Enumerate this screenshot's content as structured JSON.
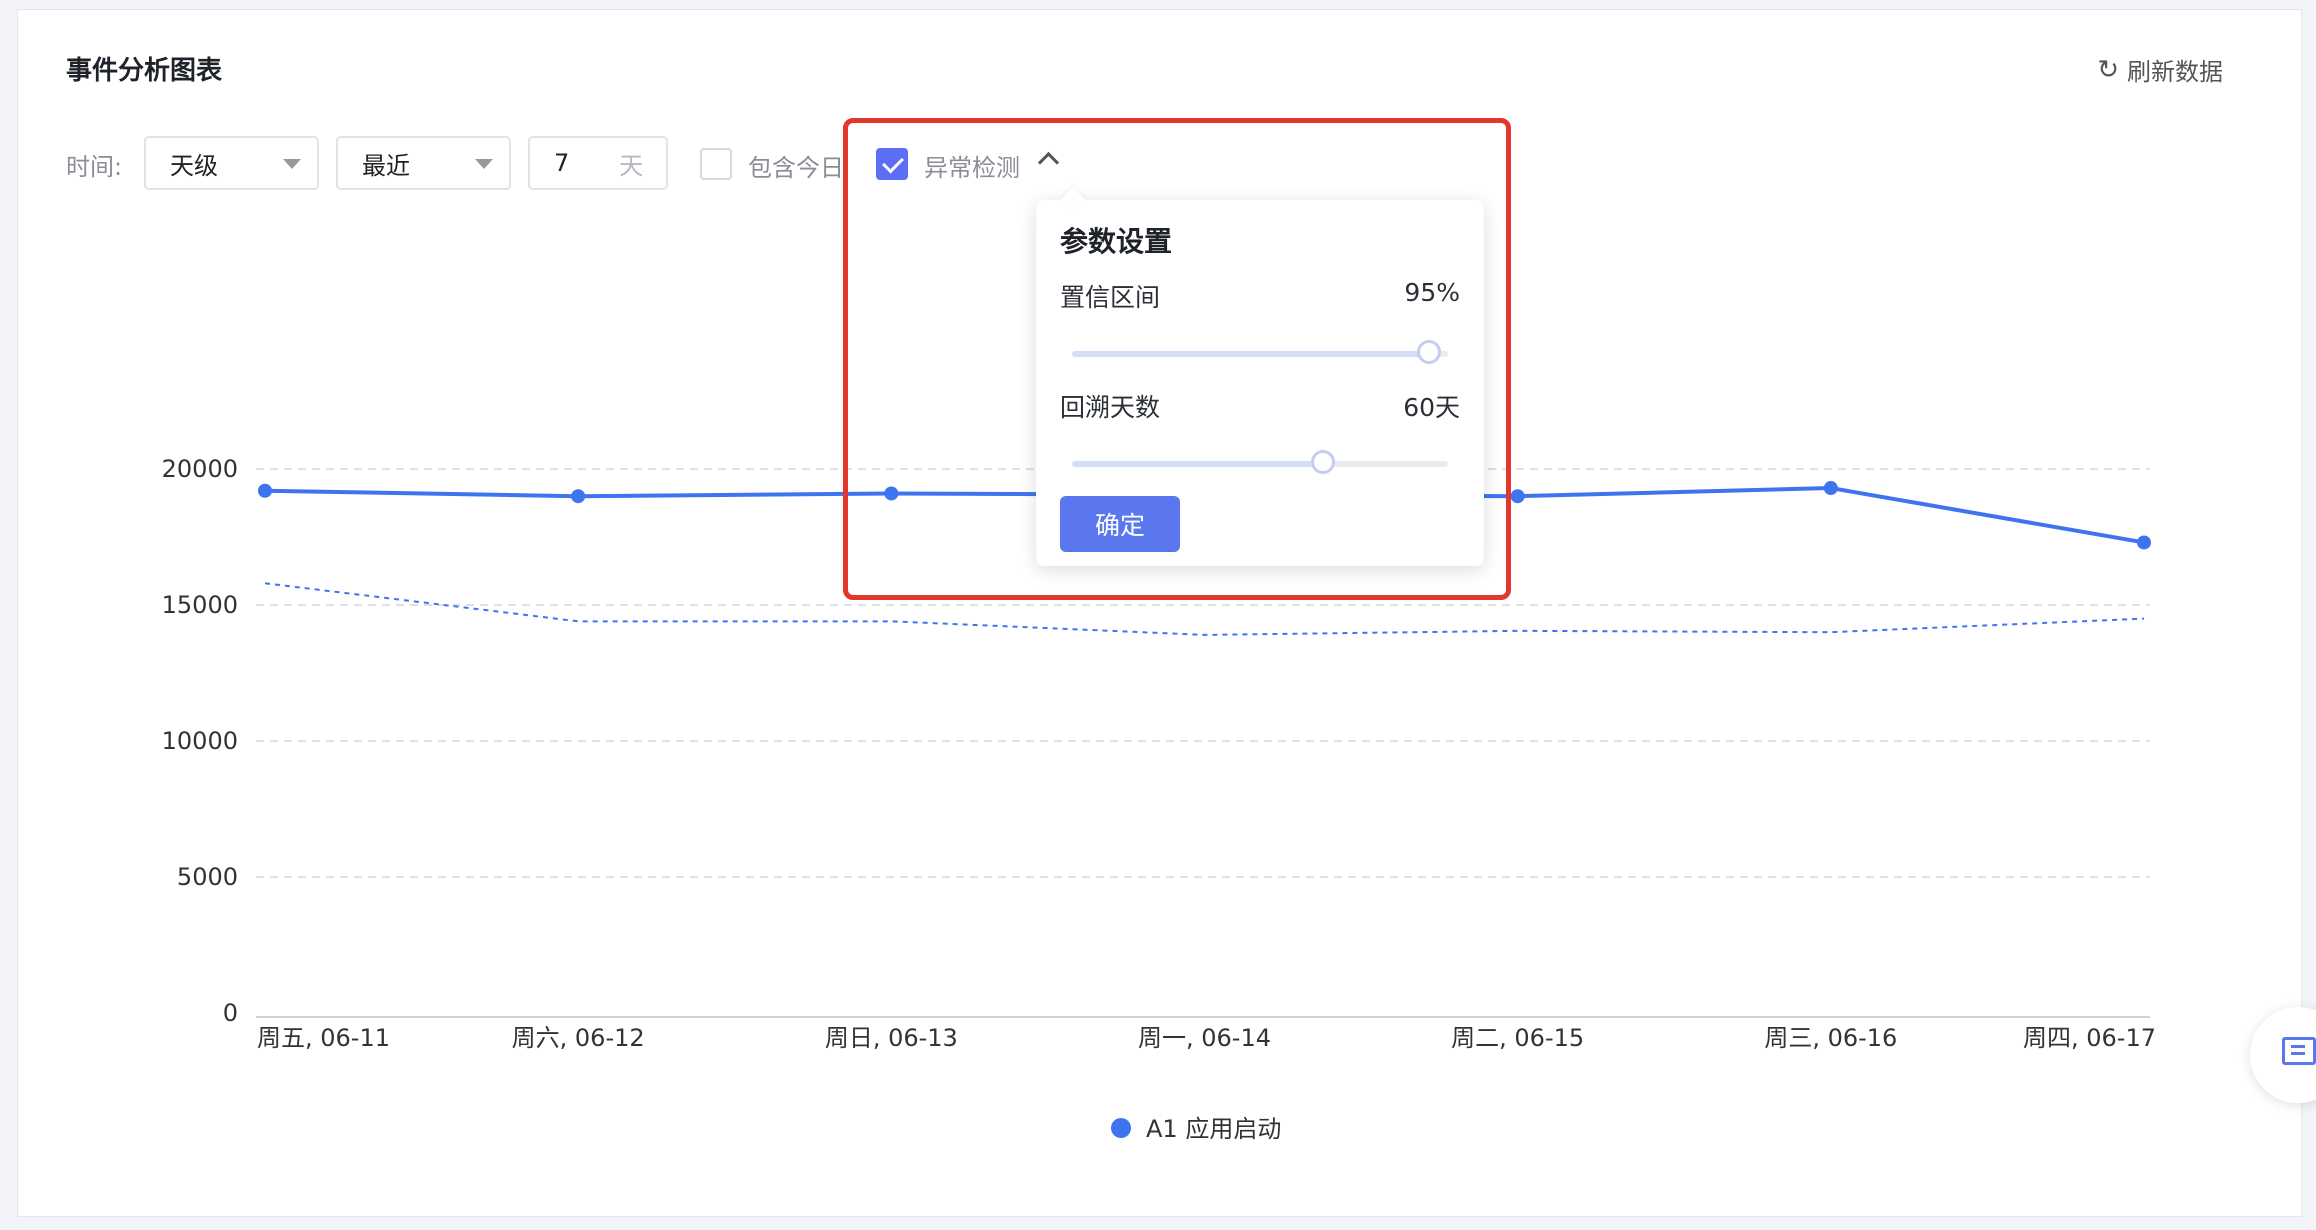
{
  "header": {
    "title": "事件分析图表",
    "refresh_label": "刷新数据"
  },
  "toolbar": {
    "time_label": "时间:",
    "granularity": "天级",
    "range_mode": "最近",
    "days_value": "7",
    "days_unit": "天",
    "include_today_label": "包含今日",
    "include_today_checked": false,
    "anomaly_label": "异常检测",
    "anomaly_checked": true
  },
  "popover": {
    "title": "参数设置",
    "confidence_label": "置信区间",
    "confidence_value": "95%",
    "confidence_level": 0.95,
    "lookback_label": "回溯天数",
    "lookback_value": "60天",
    "lookback_days": 60,
    "confirm_label": "确定"
  },
  "colors": {
    "accent": "#5b77ee",
    "series": "#3f74f0",
    "highlight": "#e0392b"
  },
  "chart_data": {
    "type": "line",
    "categories": [
      "周五, 06-11",
      "周六, 06-12",
      "周日, 06-13",
      "周一, 06-14",
      "周二, 06-15",
      "周三, 06-16",
      "周四, 06-17"
    ],
    "yticks": [
      "20000",
      "15000",
      "10000",
      "5000",
      "0"
    ],
    "ylim": [
      0,
      20000
    ],
    "series": [
      {
        "name": "A1 应用启动",
        "style": "solid",
        "values": [
          19200,
          19000,
          19100,
          19050,
          19000,
          19300,
          17300
        ]
      },
      {
        "style": "dashed",
        "values": [
          15800,
          14400,
          14400,
          13900,
          14050,
          14000,
          14500
        ]
      }
    ],
    "legend": [
      "A1 应用启动"
    ],
    "legend_position": "bottom-center",
    "grid": true
  }
}
